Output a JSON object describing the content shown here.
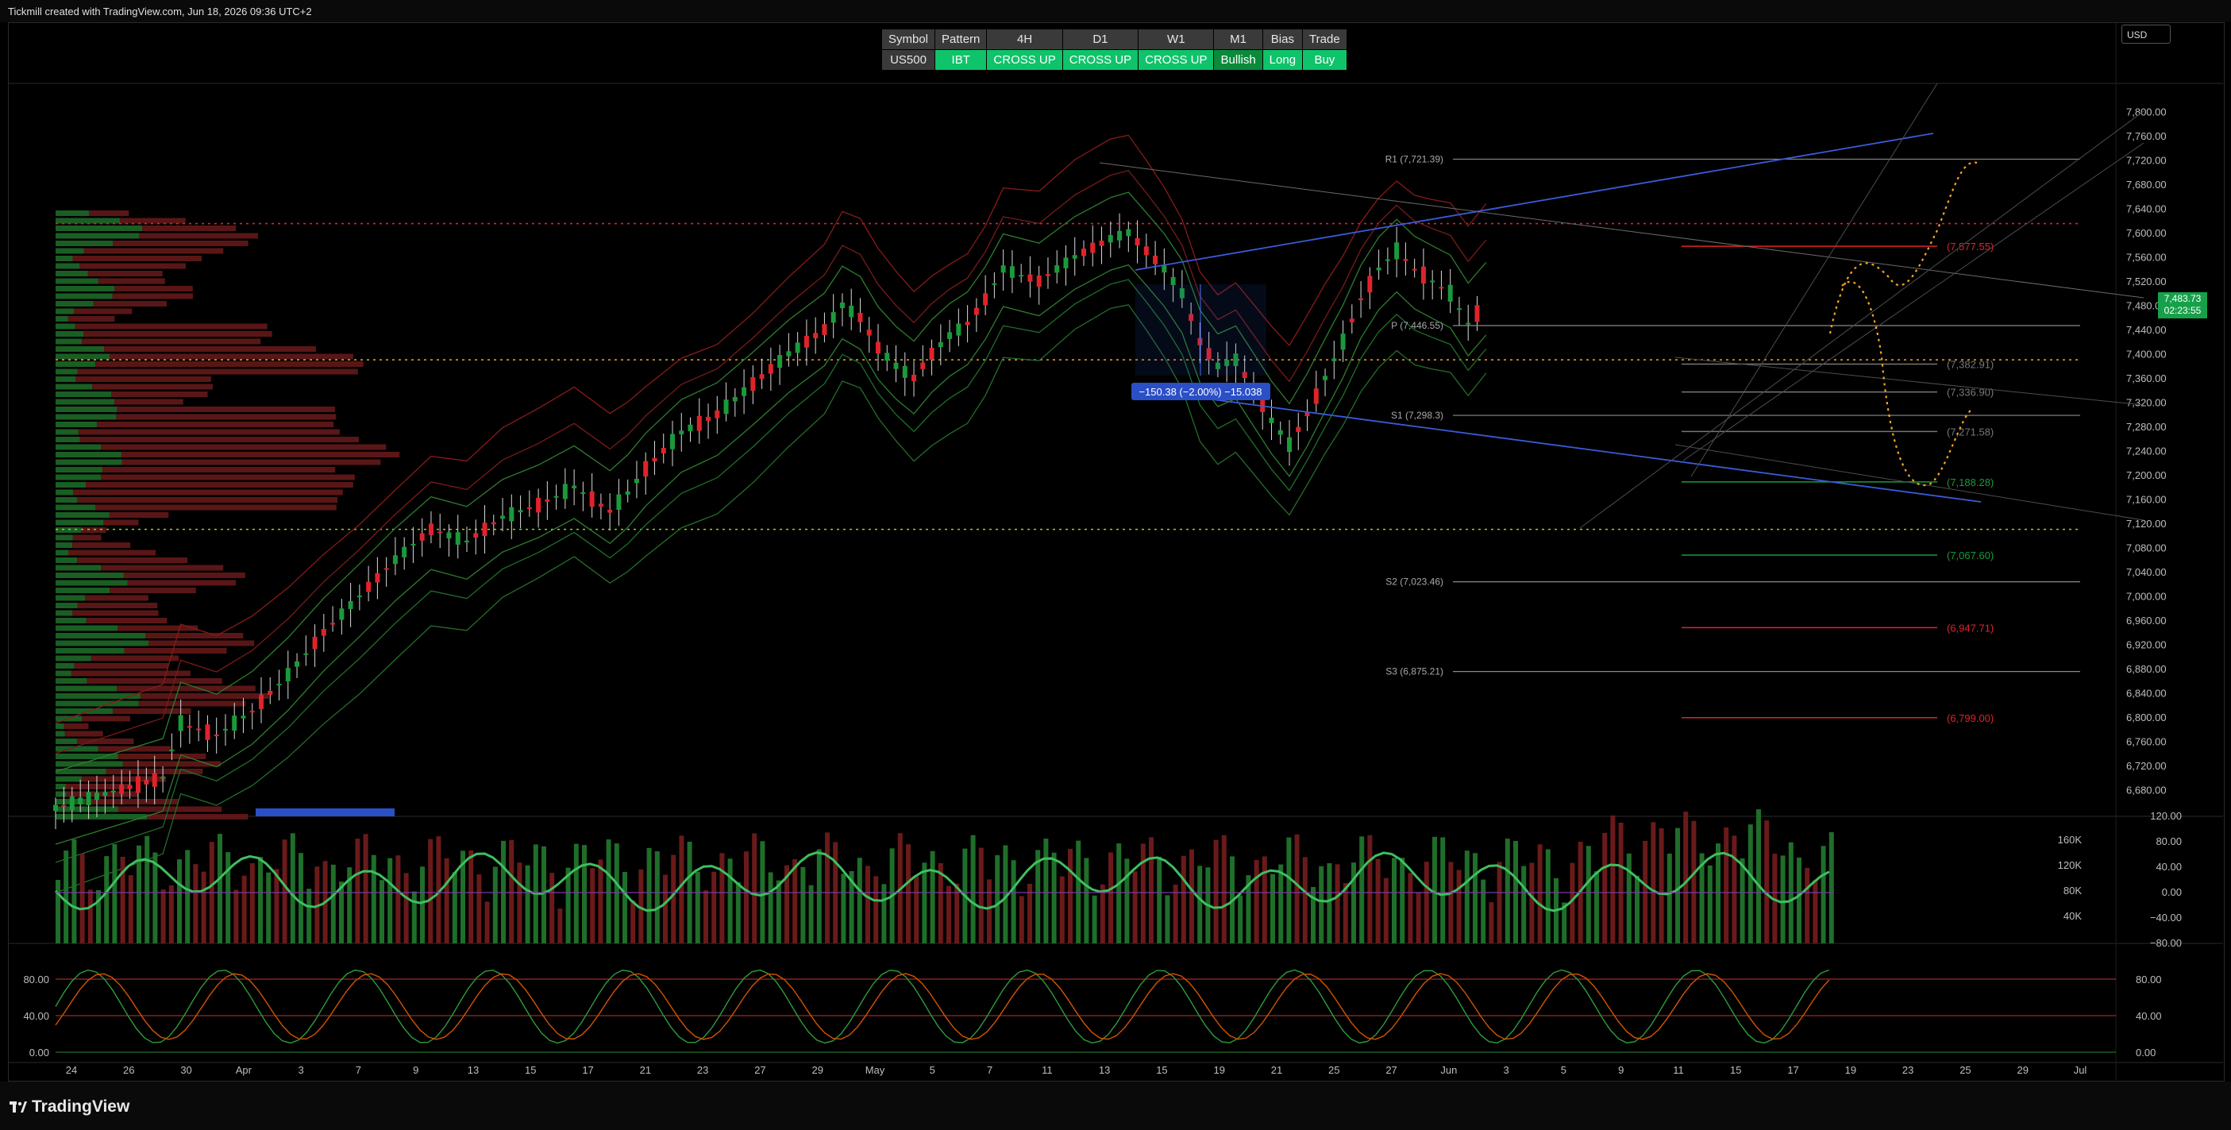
{
  "header": {
    "credit": "Tickmill created with TradingView.com, Jun 18, 2026 09:36 UTC+2"
  },
  "footer": {
    "logo": "TradingView"
  },
  "currency": "USD",
  "last_price": {
    "value": "7,483.73",
    "countdown": "02:23:55"
  },
  "signals": {
    "headers": [
      "Symbol",
      "Pattern",
      "4H",
      "D1",
      "W1",
      "M1",
      "Bias",
      "Trade"
    ],
    "values": [
      "US500",
      "IBT",
      "CROSS UP",
      "CROSS UP",
      "CROSS UP",
      "Bullish",
      "Long",
      "Buy"
    ]
  },
  "colors": {
    "up": "#1a9a3a",
    "down": "#e0232a",
    "accent_blue": "#3a5bd9",
    "orange_path": "#f5a623"
  },
  "chart_data": [
    {
      "type": "line",
      "subtype": "candlestick",
      "symbol": "US500",
      "ylim": [
        6640,
        7840
      ],
      "y_ticks": [
        "7,800.00",
        "7,760.00",
        "7,720.00",
        "7,680.00",
        "7,640.00",
        "7,600.00",
        "7,560.00",
        "7,520.00",
        "7,480.00",
        "7,440.00",
        "7,400.00",
        "7,360.00",
        "7,320.00",
        "7,280.00",
        "7,240.00",
        "7,200.00",
        "7,160.00",
        "7,120.00",
        "7,080.00",
        "7,040.00",
        "7,000.00",
        "6,960.00",
        "6,920.00",
        "6,880.00",
        "6,840.00",
        "6,800.00",
        "6,760.00",
        "6,720.00",
        "6,680.00"
      ],
      "x_ticks": [
        "24",
        "26",
        "30",
        "Apr",
        "3",
        "7",
        "9",
        "13",
        "15",
        "17",
        "21",
        "23",
        "27",
        "29",
        "May",
        "5",
        "7",
        "11",
        "13",
        "15",
        "19",
        "21",
        "25",
        "27",
        "Jun",
        "3",
        "5",
        "9",
        "11",
        "15",
        "17",
        "19",
        "23",
        "25",
        "29",
        "Jul"
      ],
      "price_path": [
        [
          0,
          6650
        ],
        [
          12,
          6700
        ],
        [
          14,
          6790
        ],
        [
          18,
          6770
        ],
        [
          22,
          6810
        ],
        [
          26,
          6870
        ],
        [
          30,
          6940
        ],
        [
          34,
          7000
        ],
        [
          38,
          7060
        ],
        [
          42,
          7110
        ],
        [
          46,
          7090
        ],
        [
          50,
          7130
        ],
        [
          54,
          7150
        ],
        [
          58,
          7180
        ],
        [
          62,
          7140
        ],
        [
          64,
          7170
        ],
        [
          66,
          7210
        ],
        [
          70,
          7270
        ],
        [
          74,
          7300
        ],
        [
          78,
          7350
        ],
        [
          82,
          7400
        ],
        [
          86,
          7440
        ],
        [
          88,
          7480
        ],
        [
          90,
          7460
        ],
        [
          92,
          7410
        ],
        [
          94,
          7380
        ],
        [
          96,
          7360
        ],
        [
          98,
          7400
        ],
        [
          100,
          7430
        ],
        [
          102,
          7450
        ],
        [
          104,
          7490
        ],
        [
          106,
          7540
        ],
        [
          110,
          7520
        ],
        [
          114,
          7560
        ],
        [
          118,
          7590
        ],
        [
          120,
          7600
        ],
        [
          122,
          7570
        ],
        [
          124,
          7540
        ],
        [
          126,
          7500
        ],
        [
          128,
          7420
        ],
        [
          130,
          7380
        ],
        [
          132,
          7390
        ],
        [
          134,
          7340
        ],
        [
          136,
          7290
        ],
        [
          138,
          7250
        ],
        [
          140,
          7300
        ],
        [
          142,
          7360
        ],
        [
          144,
          7420
        ],
        [
          146,
          7490
        ],
        [
          148,
          7540
        ],
        [
          150,
          7570
        ],
        [
          152,
          7540
        ],
        [
          154,
          7520
        ],
        [
          156,
          7500
        ],
        [
          158,
          7450
        ],
        [
          160,
          7483
        ]
      ],
      "pivot_levels": [
        {
          "label": "R1 (7,721.39)",
          "value": 7721.39
        },
        {
          "label": "P (7,446.55)",
          "value": 7446.55
        },
        {
          "label": "S1 (7,298.3)",
          "value": 7298.3
        },
        {
          "label": "S2 (7,023.46)",
          "value": 7023.46
        },
        {
          "label": "S3 (6,875.21)",
          "value": 6875.21
        }
      ],
      "target_levels": [
        {
          "label": "(7,577.55)",
          "value": 7577.55,
          "color": "#e0232a"
        },
        {
          "label": "(7,382.91)",
          "value": 7382.91,
          "color": "#777777"
        },
        {
          "label": "(7,336.90)",
          "value": 7336.9,
          "color": "#777777"
        },
        {
          "label": "(7,271.58)",
          "value": 7271.58,
          "color": "#777777"
        },
        {
          "label": "(7,188.28)",
          "value": 7188.28,
          "color": "#1a9a3a"
        },
        {
          "label": "(7,067.60)",
          "value": 7067.6,
          "color": "#1a9a3a"
        },
        {
          "label": "(6,947.71)",
          "value": 6947.71,
          "color": "#e0232a"
        },
        {
          "label": "(6,799.00)",
          "value": 6799.0,
          "color": "#e0232a"
        }
      ],
      "measure_label": "−150.38 (−2.00%) −15.038",
      "dotted_levels": [
        {
          "value": 7615,
          "color": "#e0232a"
        },
        {
          "value": 7390,
          "color": "#f5a623"
        },
        {
          "value": 7110,
          "color": "#9acd32"
        }
      ],
      "projection": "orange dotted paths up toward 7,700 and down toward 7,170"
    },
    {
      "type": "bar",
      "name_hint": "volume + oscillator pane",
      "y_ticks": [
        "160K",
        "120K",
        "80K",
        "40K"
      ],
      "osc_ticks": [
        "120.00",
        "80.00",
        "40.00",
        "0.00",
        "−40.00",
        "−80.00"
      ]
    },
    {
      "type": "line",
      "name_hint": "stochastic pane",
      "y_ticks": [
        "80.00",
        "40.00",
        "0.00"
      ],
      "bands": [
        80,
        40
      ]
    }
  ]
}
